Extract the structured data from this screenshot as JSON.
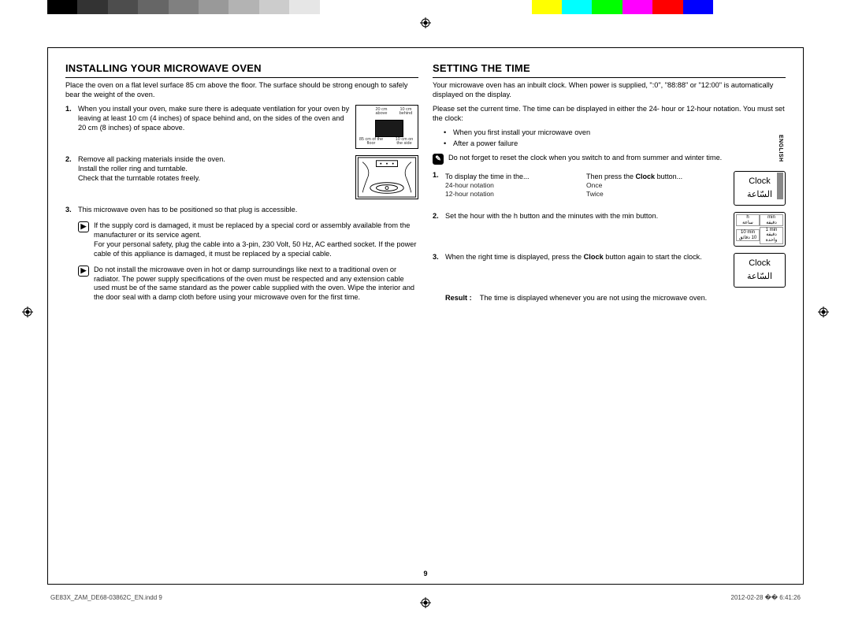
{
  "color_bar": [
    "#000000",
    "#333333",
    "#4d4d4d",
    "#666666",
    "#808080",
    "#999999",
    "#b3b3b3",
    "#cccccc",
    "#e6e6e6",
    "#ffffff",
    "#ffffff",
    "#ffffff",
    "#ffffff",
    "#ffffff",
    "#ffffff",
    "#ffffff",
    "#ffff00",
    "#00ffff",
    "#00ff00",
    "#ff00ff",
    "#ff0000",
    "#0000ff",
    "#ffffff",
    "#ffffff",
    "#ffffff"
  ],
  "left": {
    "heading": "INSTALLING YOUR MICROWAVE OVEN",
    "intro": "Place the oven on a flat level surface 85 cm above the floor. The surface should be strong enough to safely bear the weight of the oven.",
    "step1": "When you install your oven, make sure there is adequate ventilation for your oven by leaving at least 10 cm (4 inches) of space behind and, on the sides of the oven and 20 cm (8 inches) of space above.",
    "fig1": {
      "above": "20 cm above",
      "behind": "10 cm behind",
      "floor": "85 cm of the floor",
      "side": "10 cm on the side"
    },
    "step2": "Remove all packing materials inside the oven.\nInstall the roller ring and turntable.\nCheck that the turntable rotates freely.",
    "step3": "This microwave oven has to be positioned so that plug is accessible.",
    "note1": "If the supply cord is damaged, it must be replaced by a special cord or assembly available from the manufacturer or its service agent.\nFor your personal safety, plug the cable into a 3-pin, 230 Volt, 50 Hz, AC earthed socket. If the power cable of this appliance is damaged, it must be replaced by a special cable.",
    "note2": "Do not install the microwave oven in hot or damp surroundings like next to a traditional oven or radiator. The power supply specifications of the oven must be respected and any extension cable used must be of the same standard as the power cable supplied with the oven. Wipe the interior and the door seal with a damp cloth before using your microwave oven for the first time."
  },
  "right": {
    "heading": "SETTING THE TIME",
    "intro1": "Your microwave oven has an inbuilt clock. When power is supplied, \":0\", \"88:88\" or \"12:00\" is automatically displayed on the display.",
    "intro2": "Please set the current time. The time can be displayed in either the 24- hour or 12-hour notation. You must set the clock:",
    "bullets": [
      "When you first install your microwave oven",
      "After a power failure"
    ],
    "warn": "Do not forget to reset the clock when you switch to and from summer and winter time.",
    "step1": {
      "lead_a": "To display the time in the...",
      "lead_b_pre": "Then press the ",
      "lead_b_bold": "Clock",
      "lead_b_post": " button...",
      "rows": [
        {
          "a": "24-hour notation",
          "b": "Once"
        },
        {
          "a": "12-hour notation",
          "b": "Twice"
        }
      ]
    },
    "step2": "Set the hour with the h button and the minutes with the min button.",
    "step3_pre": "When the right time is displayed, press the ",
    "step3_bold": "Clock",
    "step3_post": " button again to start the clock.",
    "result_label": "Result :",
    "result_text": "The time is displayed whenever you are not using the microwave oven.",
    "clock_btn": {
      "en": "Clock",
      "ar": "السّاعة"
    },
    "hmin_btn": {
      "h": "h",
      "h_ar": "ساعة",
      "min": "min",
      "min_ar": "دقيقة",
      "ten": "10 min",
      "ten_ar": "10 دقائق",
      "one": "1 min",
      "one_ar": "دقيقة واحدة"
    }
  },
  "lang_tab": "ENGLISH",
  "page_number": "9",
  "footer_left": "GE83X_ZAM_DE68-03862C_EN.indd   9",
  "footer_right": "2012-02-28   �� 6:41:26"
}
